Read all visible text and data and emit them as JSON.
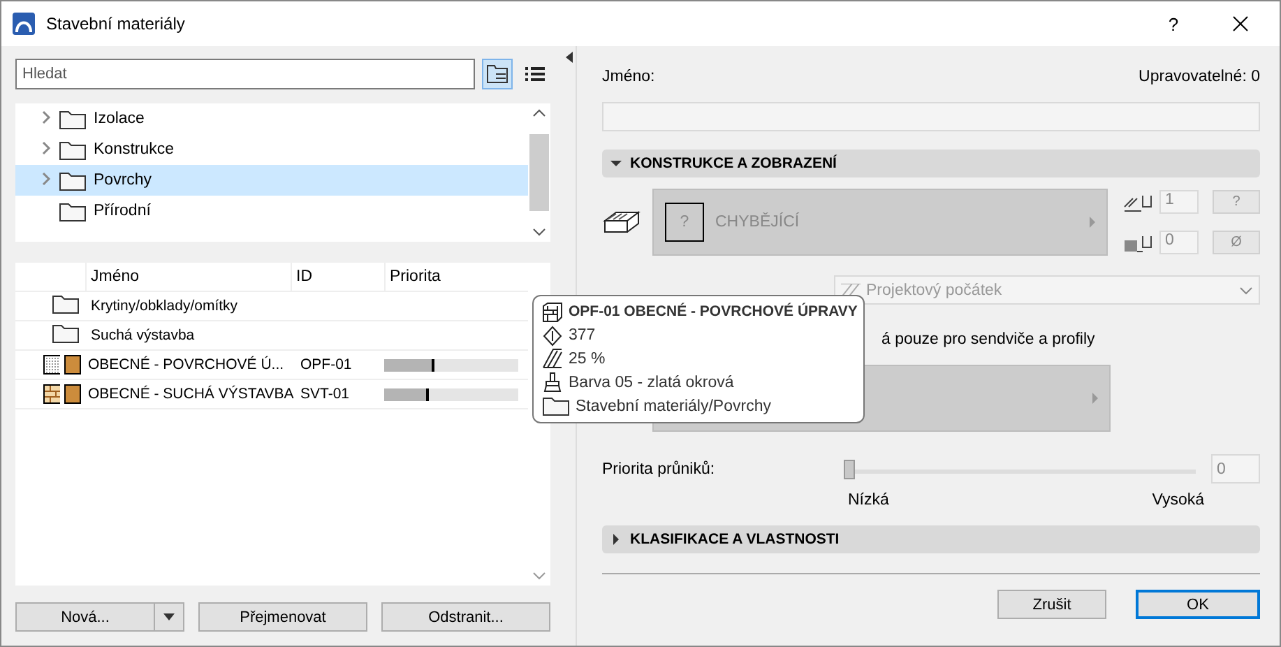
{
  "window": {
    "title": "Stavební materiály",
    "help": "?"
  },
  "search": {
    "placeholder": "Hledat"
  },
  "view_buttons": [
    {
      "kind": "tree",
      "selected": true
    },
    {
      "kind": "list",
      "selected": false
    }
  ],
  "folder_tree": [
    {
      "label": "Izolace",
      "expandable": true,
      "selected": false
    },
    {
      "label": "Konstrukce",
      "expandable": true,
      "selected": false
    },
    {
      "label": "Povrchy",
      "expandable": true,
      "selected": true
    },
    {
      "label": "Přírodní",
      "expandable": false,
      "selected": false
    }
  ],
  "list": {
    "columns": [
      "Jméno",
      "ID",
      "Priorita"
    ],
    "rows": [
      {
        "kind": "folder",
        "name": "Krytiny/obklady/omítky"
      },
      {
        "kind": "folder",
        "name": "Suchá výstavba"
      },
      {
        "kind": "material",
        "pattern": {
          "kind": "dots"
        },
        "name": "OBECNÉ - POVRCHOVÉ Ú...",
        "id": "OPF-01",
        "level": 0.37
      },
      {
        "kind": "material",
        "pattern": {
          "kind": "bricks"
        },
        "name": "OBECNÉ - SUCHÁ VÝSTAVBA",
        "id": "SVT-01",
        "level": 0.33
      }
    ]
  },
  "tooltip": {
    "title": "OPF-01 OBECNÉ - POVRCHOVÉ ÚPRAVY",
    "lines": [
      {
        "kind": "number",
        "text": "377"
      },
      {
        "kind": "hatch",
        "text": "25 %"
      },
      {
        "kind": "brush",
        "text": "Barva 05 - zlatá okrová"
      },
      {
        "kind": "folder",
        "text": "Stavební materiály/Povrchy"
      }
    ]
  },
  "left_buttons": [
    {
      "label": "Nová...",
      "kind": "split"
    },
    {
      "label": "Přejmenovat",
      "kind": "plain"
    },
    {
      "label": "Odstranit...",
      "kind": "plain"
    }
  ],
  "name_label": "Jméno:",
  "editable": "Upravovatelné: 0",
  "construction": {
    "title": "KONSTRUKCE A ZOBRAZENÍ",
    "expanded": true,
    "surface": {
      "mark": "?",
      "label": "CHYBĚJÍCÍ"
    },
    "pens": [
      {
        "kind": "hatch",
        "value": "1",
        "button": "?"
      },
      {
        "kind": "fill",
        "value": "0",
        "button": "Ø"
      }
    ],
    "origin": "Projektový počátek",
    "checkbox_text": "á pouze pro sendviče a profily",
    "priority": {
      "label": "Priorita průniků:",
      "value": "0",
      "level": 0,
      "low": "Nízká",
      "high": "Vysoká"
    }
  },
  "classification": {
    "title": "KLASIFIKACE A VLASTNOSTI",
    "expanded": false
  },
  "footer_buttons": [
    {
      "label": "Zrušit",
      "default": false
    },
    {
      "label": "OK",
      "default": true
    }
  ]
}
